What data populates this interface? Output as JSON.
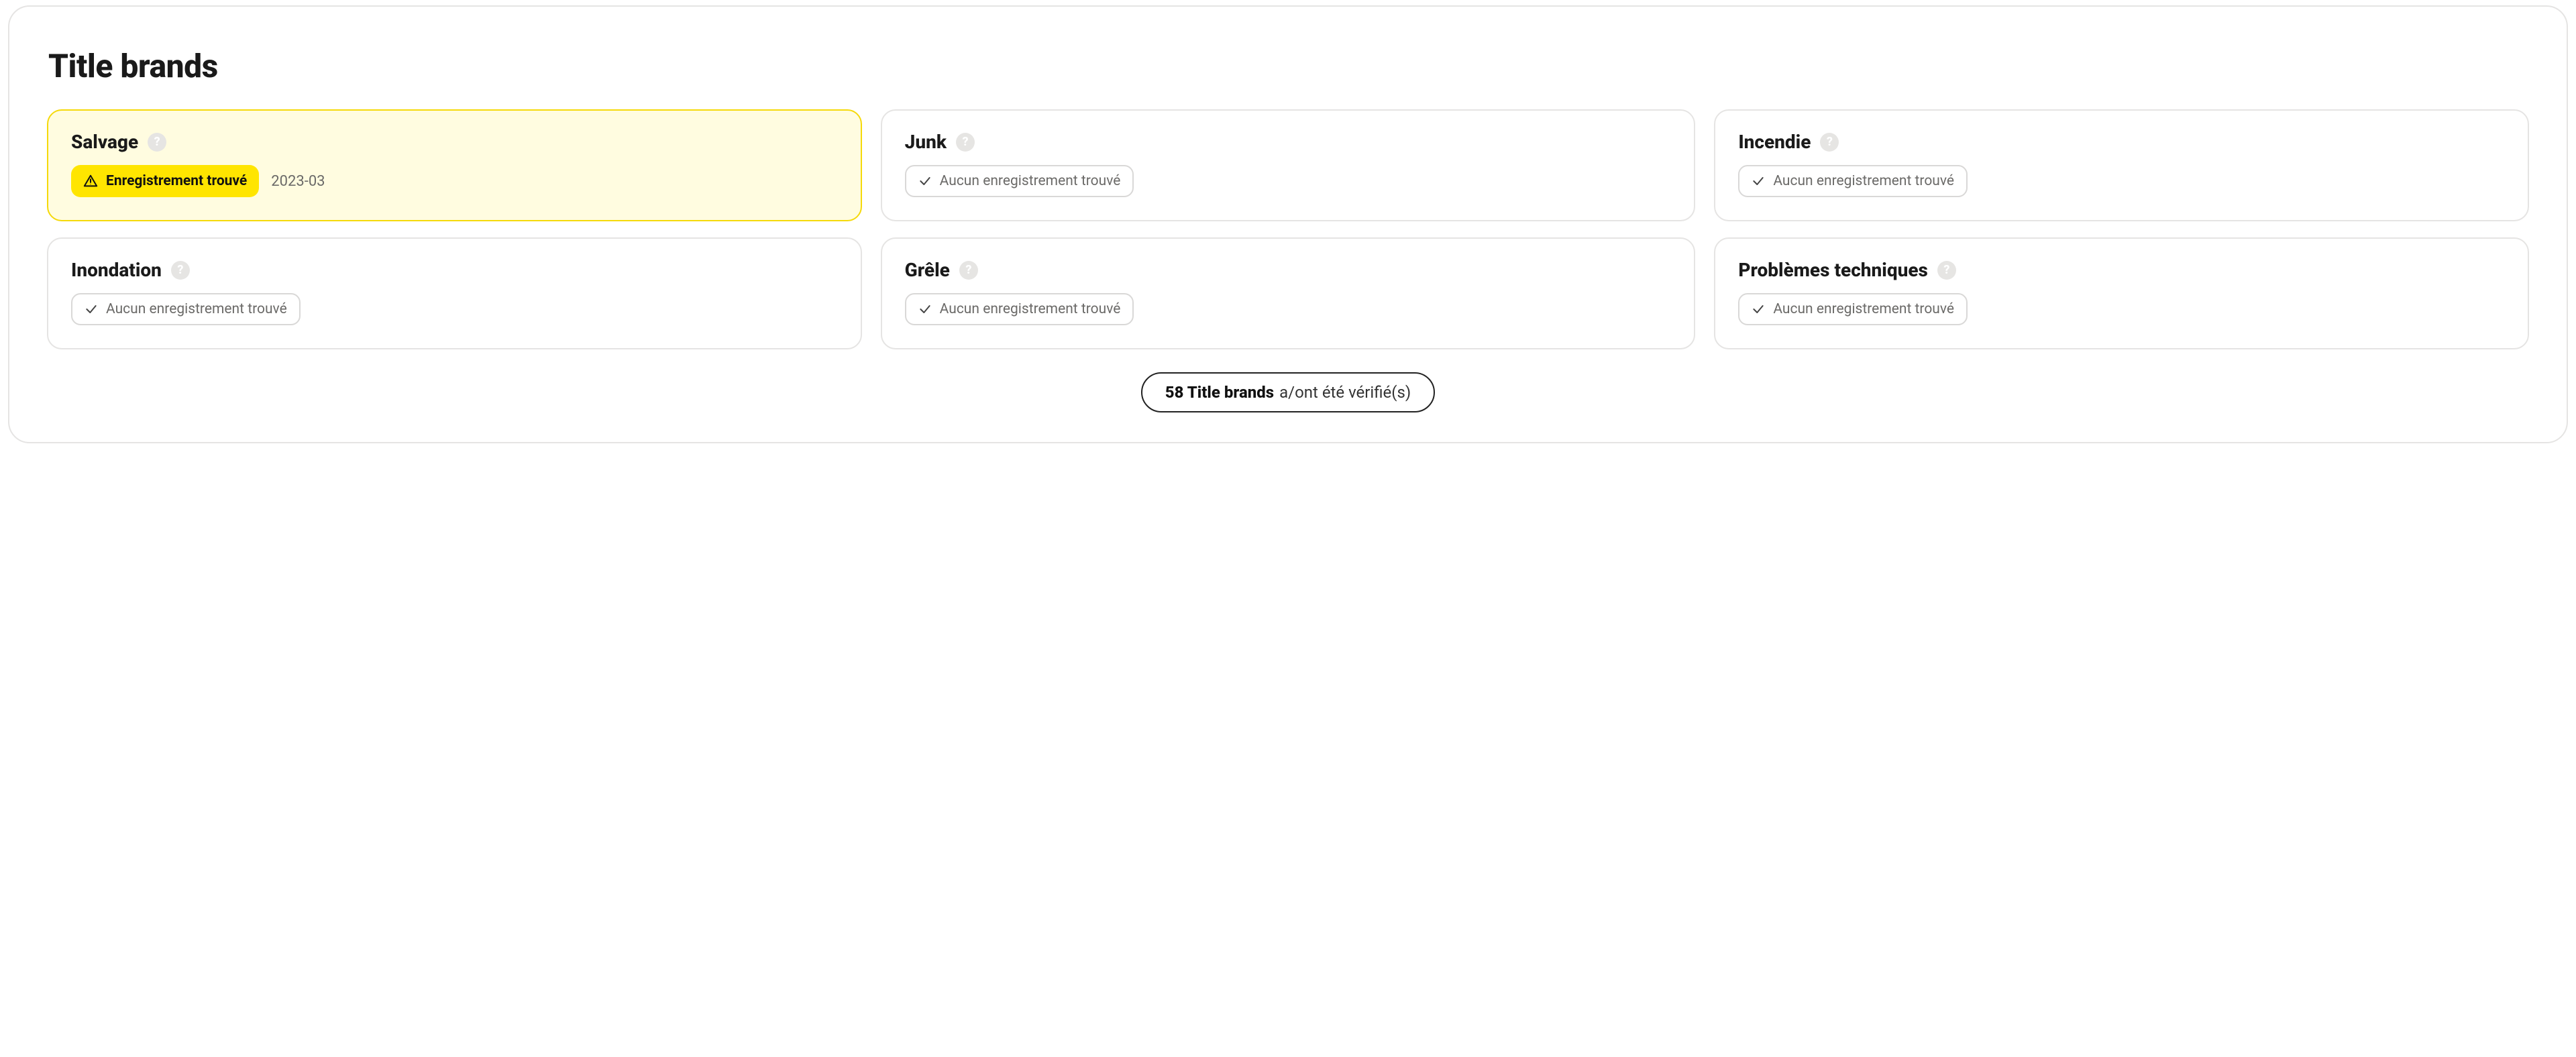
{
  "section_title": "Title brands",
  "status_text": {
    "record_found": "Enregistrement trouvé",
    "no_record": "Aucun enregistrement trouvé"
  },
  "cards": [
    {
      "id": "salvage",
      "label": "Salvage",
      "found": true,
      "date": "2023-03"
    },
    {
      "id": "junk",
      "label": "Junk",
      "found": false
    },
    {
      "id": "fire",
      "label": "Incendie",
      "found": false
    },
    {
      "id": "flood",
      "label": "Inondation",
      "found": false
    },
    {
      "id": "hail",
      "label": "Grêle",
      "found": false
    },
    {
      "id": "technical",
      "label": "Problèmes techniques",
      "found": false
    }
  ],
  "summary": {
    "count": "58",
    "label": "Title brands",
    "suffix": "a/ont été vérifié(s)"
  }
}
